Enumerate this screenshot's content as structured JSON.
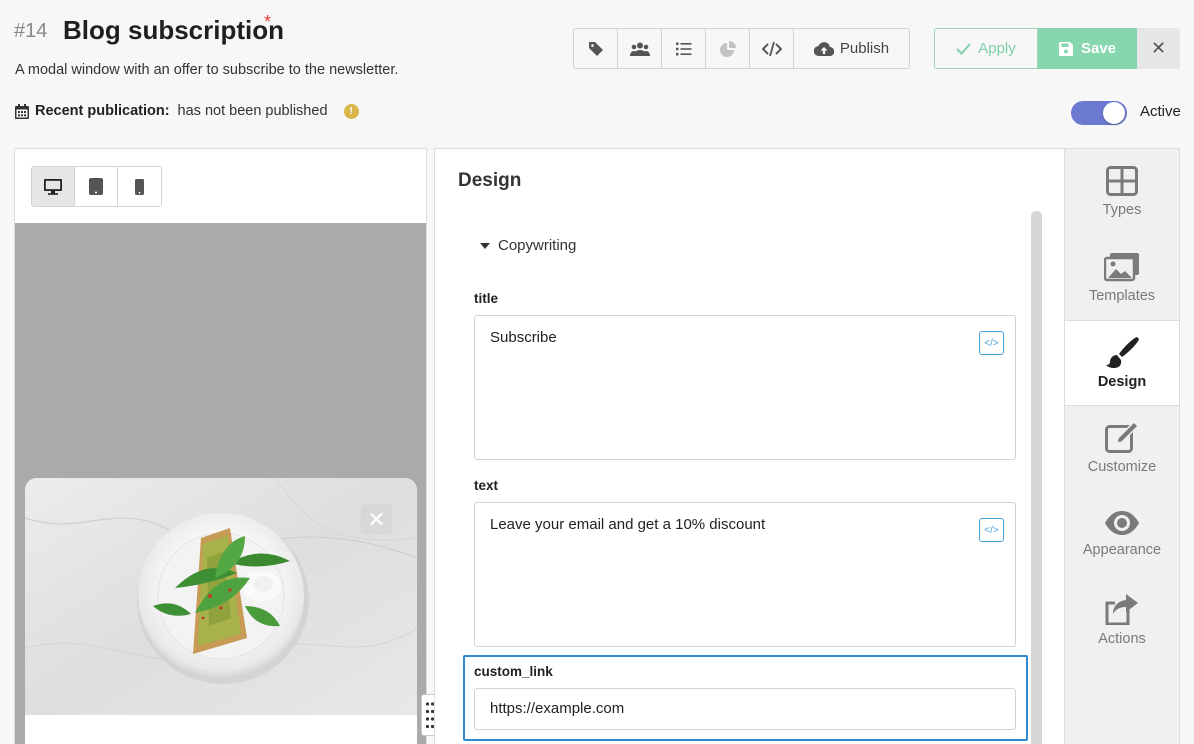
{
  "header": {
    "id": "#14",
    "title": "Blog subscription",
    "required_mark": "*",
    "description": "A modal window with an offer to subscribe to the newsletter."
  },
  "toolbar": {
    "icons": [
      "tag-icon",
      "users-icon",
      "list-icon",
      "chart-pie-icon",
      "code-icon"
    ],
    "publish_label": "Publish",
    "apply_label": "Apply",
    "save_label": "Save",
    "close_label": "✕"
  },
  "publication": {
    "label": "Recent publication:",
    "value": "has not been published",
    "warning_glyph": "!"
  },
  "status": {
    "active_label": "Active",
    "active": true
  },
  "preview": {
    "devices": [
      "desktop",
      "tablet",
      "mobile"
    ],
    "selected_device": "desktop",
    "modal_close": "✕"
  },
  "design": {
    "title": "Design",
    "section_label": "Copywriting",
    "fields": {
      "title_label": "title",
      "title_value": "Subscribe",
      "text_label": "text",
      "text_value": "Leave your email and get a 10% discount",
      "link_label": "custom_link",
      "link_value": "https://example.com",
      "code_glyph": "</>"
    }
  },
  "sidebar": {
    "items": [
      {
        "label": "Types",
        "icon": "grid-icon"
      },
      {
        "label": "Templates",
        "icon": "images-icon"
      },
      {
        "label": "Design",
        "icon": "brush-icon"
      },
      {
        "label": "Customize",
        "icon": "edit-icon"
      },
      {
        "label": "Appearance",
        "icon": "eye-icon"
      },
      {
        "label": "Actions",
        "icon": "share-icon"
      }
    ],
    "selected": "Design"
  },
  "colors": {
    "accent_green": "#86d6ae",
    "toggle_blue": "#6b79d1",
    "focus_blue": "#2e8bd1",
    "required_red": "#e0413f"
  }
}
